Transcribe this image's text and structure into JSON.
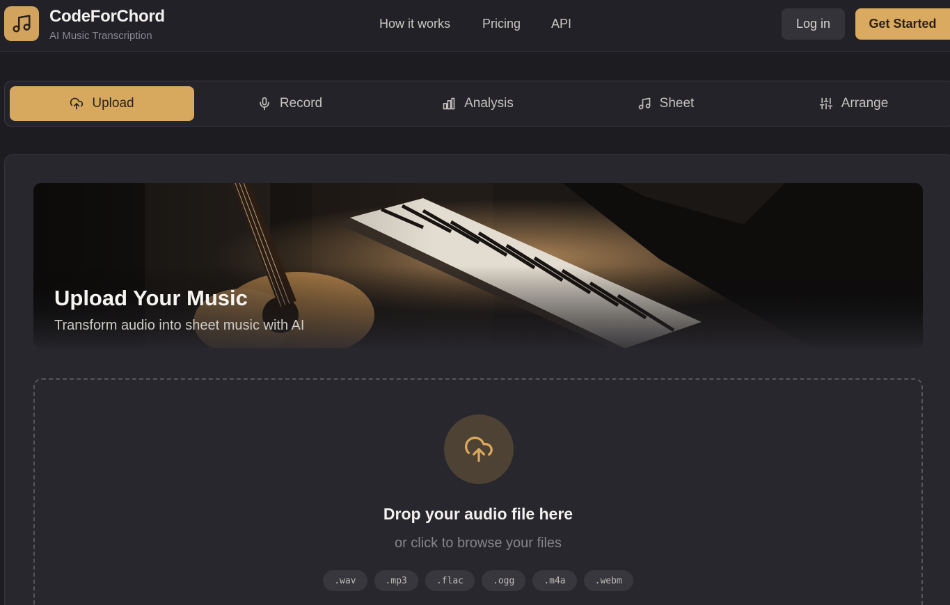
{
  "brand": {
    "name": "CodeForChord",
    "tagline": "AI Music Transcription",
    "logo_icon": "music-note-icon",
    "accent": "#d9aa5f"
  },
  "nav": {
    "links": [
      "How it works",
      "Pricing",
      "API"
    ],
    "login_label": "Log in",
    "cta_label": "Get Started"
  },
  "tabs": [
    {
      "label": "Upload",
      "icon": "upload-cloud-icon",
      "active": true
    },
    {
      "label": "Record",
      "icon": "microphone-icon",
      "active": false
    },
    {
      "label": "Analysis",
      "icon": "bar-chart-icon",
      "active": false
    },
    {
      "label": "Sheet",
      "icon": "music-note-icon",
      "active": false
    },
    {
      "label": "Arrange",
      "icon": "sliders-icon",
      "active": false
    }
  ],
  "hero": {
    "title": "Upload Your Music",
    "subtitle": "Transform audio into sheet music with AI"
  },
  "dropzone": {
    "icon": "upload-cloud-icon",
    "title": "Drop your audio file here",
    "subtitle": "or click to browse your files",
    "formats": [
      ".wav",
      ".mp3",
      ".flac",
      ".ogg",
      ".m4a",
      ".webm"
    ]
  }
}
